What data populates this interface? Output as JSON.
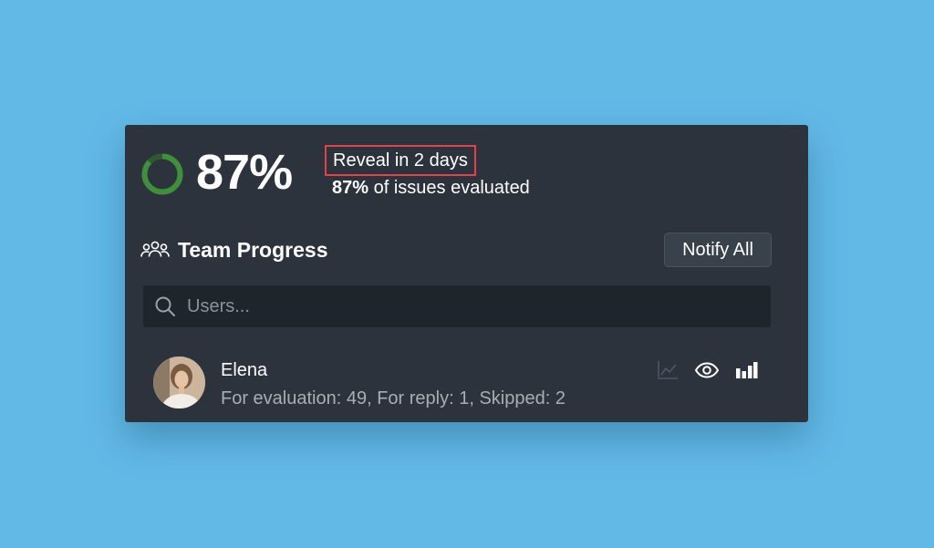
{
  "summary": {
    "percent": "87%",
    "progress_fraction": 0.87,
    "reveal_text": "Reveal in 2 days",
    "issues_percent": "87%",
    "issues_text": " of issues evaluated"
  },
  "team": {
    "title": "Team Progress",
    "notify_label": "Notify All"
  },
  "search": {
    "placeholder": "Users..."
  },
  "users": [
    {
      "name": "Elena",
      "stats": "For evaluation: 49, For reply: 1, Skipped: 2"
    }
  ],
  "colors": {
    "background": "#62b9e6",
    "card": "#2c333d",
    "ring": "#3f8f3c",
    "highlight_border": "#e0434b"
  },
  "icons": {
    "team": "team-icon",
    "search": "search-icon",
    "chart": "line-chart-icon",
    "eye": "eye-icon",
    "bars": "bar-chart-icon"
  }
}
